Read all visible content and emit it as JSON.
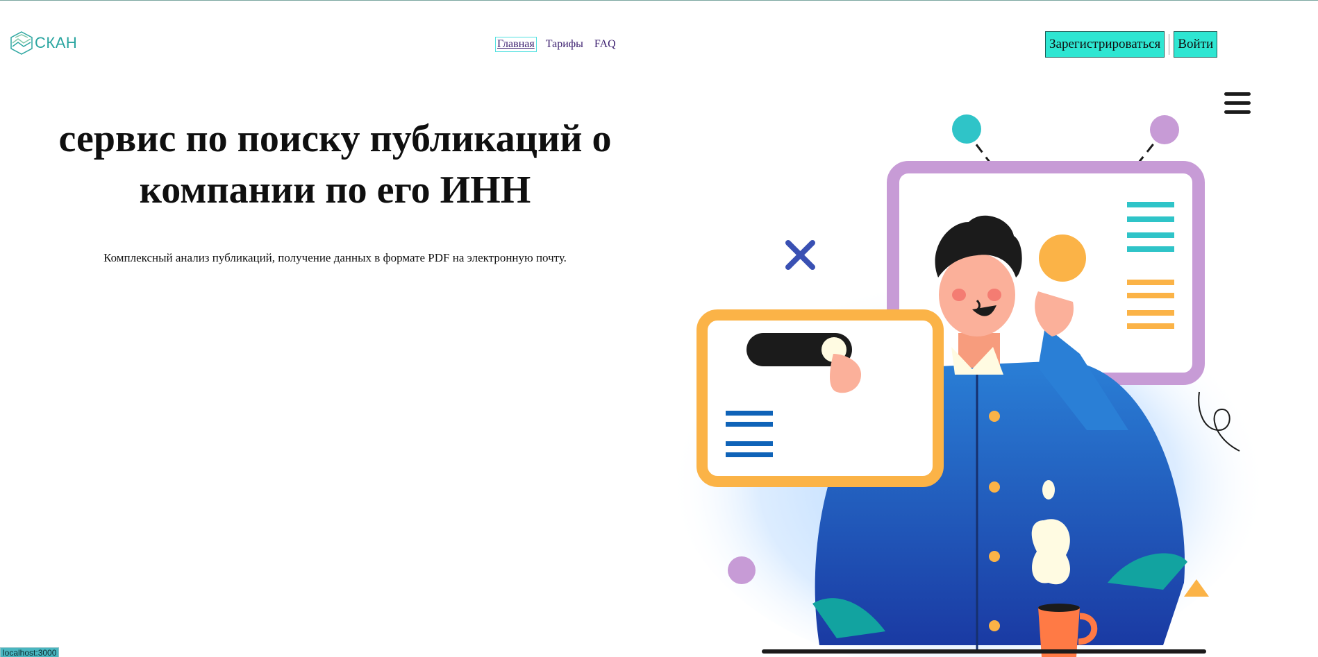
{
  "header": {
    "logo_text": "СКАН",
    "nav": [
      {
        "label": "Главная",
        "active": true
      },
      {
        "label": "Тарифы",
        "active": false
      },
      {
        "label": "FAQ",
        "active": false
      }
    ],
    "register_label": "Зарегистрироваться",
    "login_label": "Войти"
  },
  "hero": {
    "title": "сервис по поиску публикаций о компании по его ИНН",
    "subtitle": "Комплексный анализ публикаций, получение данных в формате PDF на электронную почту."
  },
  "menu_icon": "hamburger-menu-icon",
  "status_bar": {
    "url": "localhost:3000"
  },
  "colors": {
    "accent": "#2ee6d2",
    "logo": "#2aa5a0",
    "nav_link": "#3a1d6e"
  }
}
